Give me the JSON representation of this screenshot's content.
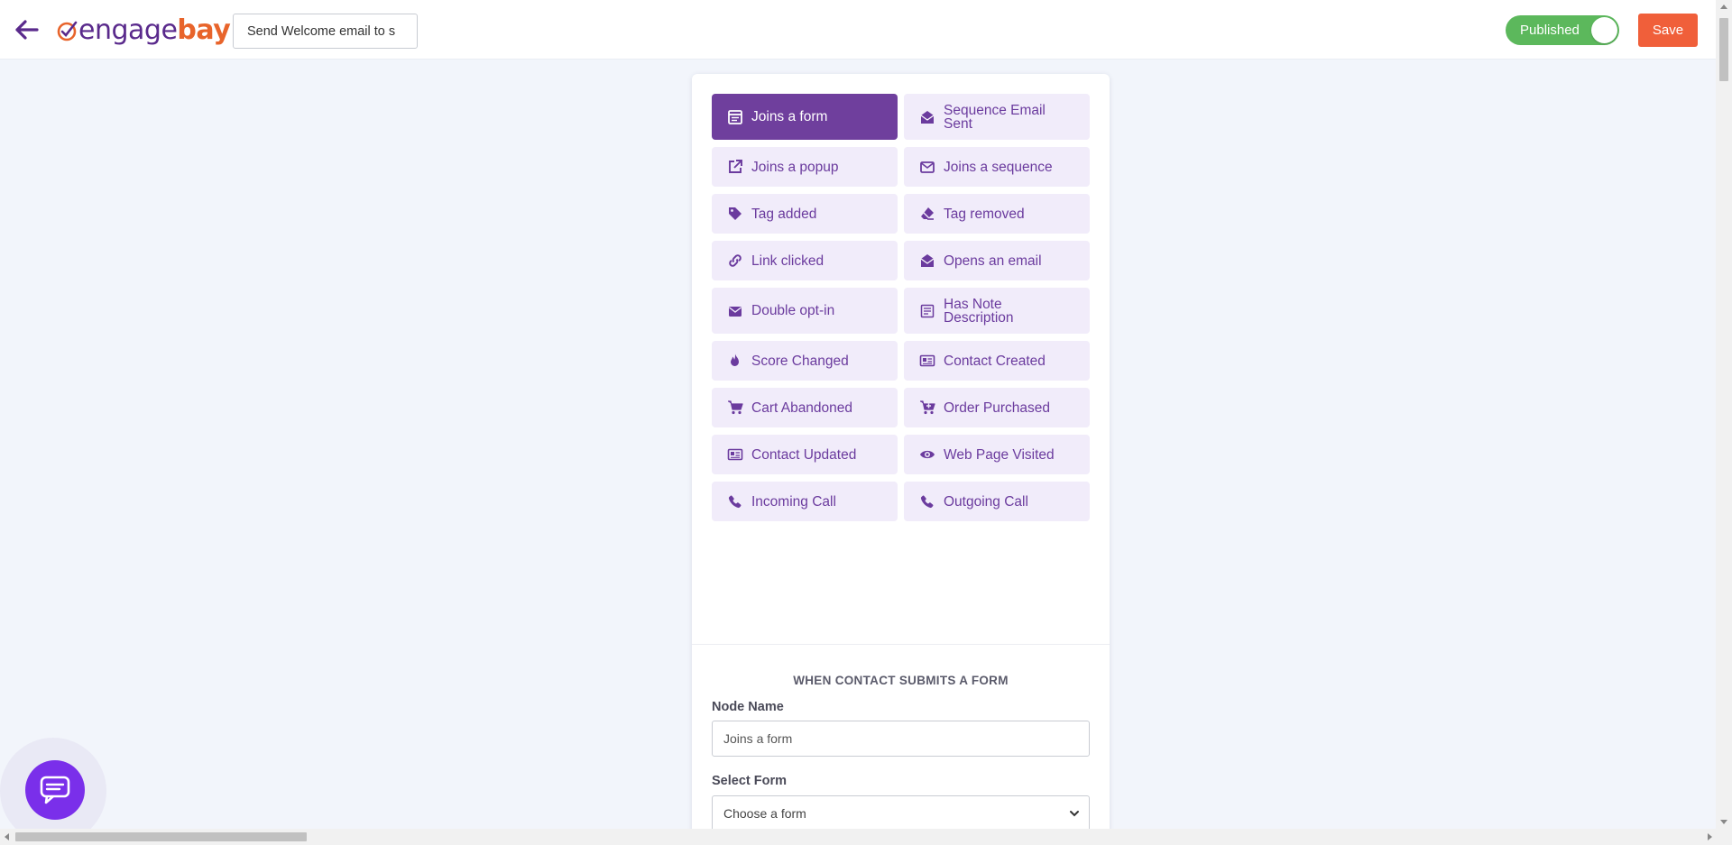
{
  "header": {
    "logo_part1": "engage",
    "logo_part2": "bay",
    "workflow_title": "Send Welcome email to s",
    "publish_label": "Published",
    "save_label": "Save"
  },
  "colors": {
    "brand_purple": "#6f3f9d",
    "brand_orange": "#f05f3a",
    "toggle_green": "#5cb85c",
    "chat_purple": "#7a2fea"
  },
  "triggers": [
    {
      "label": "Joins a form",
      "icon": "form-icon",
      "active": true
    },
    {
      "label": "Sequence Email Sent",
      "icon": "envelope-open-icon",
      "active": false
    },
    {
      "label": "Joins a popup",
      "icon": "external-link-icon",
      "active": false
    },
    {
      "label": "Joins a sequence",
      "icon": "envelope-outline-icon",
      "active": false
    },
    {
      "label": "Tag added",
      "icon": "tag-icon",
      "active": false
    },
    {
      "label": "Tag removed",
      "icon": "eraser-icon",
      "active": false
    },
    {
      "label": "Link clicked",
      "icon": "link-icon",
      "active": false
    },
    {
      "label": "Opens an email",
      "icon": "envelope-open-icon",
      "active": false
    },
    {
      "label": "Double opt-in",
      "icon": "envelope-icon",
      "active": false
    },
    {
      "label": "Has Note Description",
      "icon": "note-icon",
      "active": false
    },
    {
      "label": "Score Changed",
      "icon": "fire-icon",
      "active": false
    },
    {
      "label": "Contact Created",
      "icon": "contact-card-icon",
      "active": false
    },
    {
      "label": "Cart Abandoned",
      "icon": "cart-icon",
      "active": false
    },
    {
      "label": "Order Purchased",
      "icon": "cart-plus-icon",
      "active": false
    },
    {
      "label": "Contact Updated",
      "icon": "contact-card-icon",
      "active": false
    },
    {
      "label": "Web Page Visited",
      "icon": "eye-icon",
      "active": false
    },
    {
      "label": "Incoming Call",
      "icon": "phone-icon",
      "active": false
    },
    {
      "label": "Outgoing Call",
      "icon": "phone-icon",
      "active": false
    }
  ],
  "form": {
    "section_heading": "WHEN CONTACT SUBMITS A FORM",
    "node_name_label": "Node Name",
    "node_name_value": "Joins a form",
    "select_form_label": "Select Form",
    "select_form_value": "Choose a form"
  }
}
